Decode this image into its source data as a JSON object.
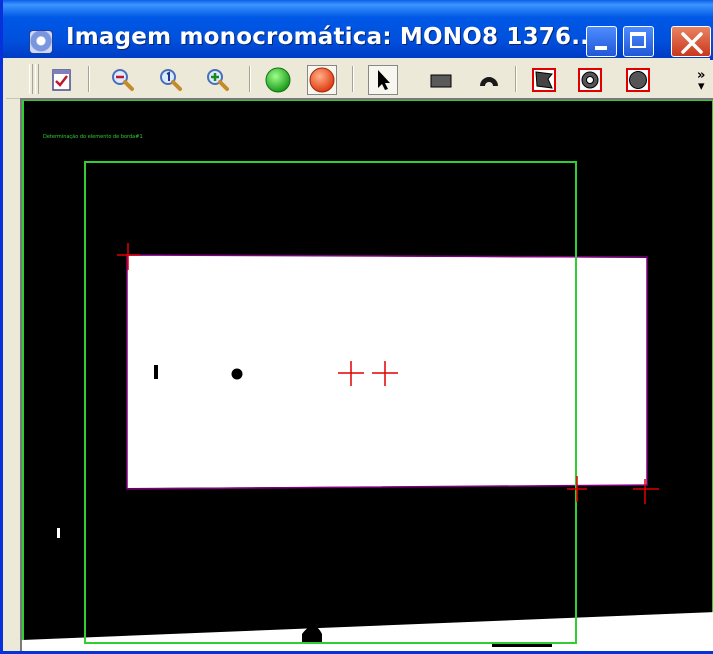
{
  "window": {
    "title": "Imagem monocromática: MONO8 1376...",
    "controls": [
      "minimize",
      "maximize",
      "close"
    ]
  },
  "toolbar": {
    "tools": [
      {
        "icon": "checklist-icon"
      },
      {
        "icon": "zoom-out-icon"
      },
      {
        "icon": "zoom-reset-icon"
      },
      {
        "icon": "zoom-in-icon"
      },
      {
        "icon": "green-circle-icon"
      },
      {
        "icon": "red-circle-icon"
      },
      {
        "icon": "arrow-pointer-icon",
        "state": "pressed"
      },
      {
        "icon": "rectangle-tool-icon"
      },
      {
        "icon": "arc-tool-icon"
      },
      {
        "icon": "polygon-region-icon"
      },
      {
        "icon": "ring-region-icon"
      },
      {
        "icon": "circle-region-icon"
      }
    ],
    "overflow_label": "»"
  },
  "image_view": {
    "overlay_text": "Determinação do elemento de borda#1",
    "colors": {
      "background": "#000000",
      "object": "#FFFFFF",
      "roi_outline": "#32CD32",
      "fit_outline": "#800080",
      "markers": "#FF0000"
    }
  }
}
